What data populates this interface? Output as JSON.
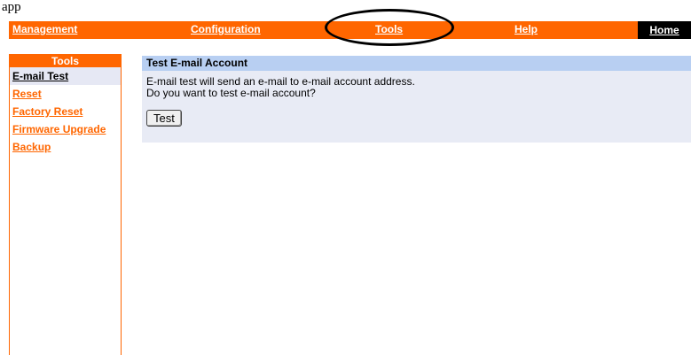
{
  "page": {
    "caption": "app"
  },
  "nav": {
    "items": [
      {
        "label": "Management"
      },
      {
        "label": "Configuration"
      },
      {
        "label": "Tools"
      },
      {
        "label": "Help"
      }
    ],
    "home_label": "Home"
  },
  "sidebar": {
    "header": "Tools",
    "items": [
      {
        "label": "E-mail Test",
        "active": true
      },
      {
        "label": "Reset"
      },
      {
        "label": "Factory Reset"
      },
      {
        "label": "Firmware Upgrade"
      },
      {
        "label": "Backup"
      }
    ]
  },
  "main": {
    "title": "Test E-mail Account",
    "line1": "E-mail test will send an e-mail to e-mail account address.",
    "line2": "Do you want to test e-mail account?",
    "button_label": "Test"
  },
  "colors": {
    "accent": "#ff6600",
    "section_header": "#b8cff2",
    "section_body": "#e8ebf5",
    "active_item": "#e6e8f4"
  }
}
